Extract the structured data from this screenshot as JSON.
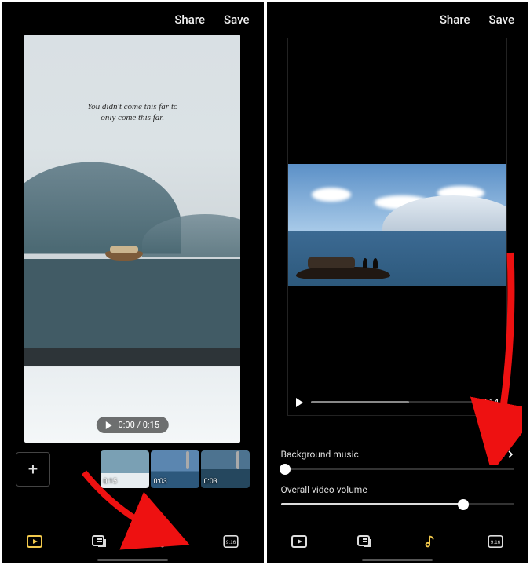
{
  "header": {
    "share": "Share",
    "save": "Save"
  },
  "left": {
    "caption": "You didn't come this far to\nonly come this far.",
    "playback_time": "0:00 / 0:15",
    "clips": [
      {
        "duration": "0:15"
      },
      {
        "duration": "0:03"
      },
      {
        "duration": "0:03"
      }
    ]
  },
  "right": {
    "playback_time_remaining": "0:14",
    "progress_pct": 60,
    "background_music_label": "Background music",
    "background_music_action": "Add",
    "bg_music_slider_value_pct": 2,
    "overall_volume_label": "Overall video volume",
    "overall_volume_value_pct": 78
  },
  "nav": {
    "items": [
      "edit-icon",
      "text-icon",
      "music-icon",
      "aspect-icon"
    ],
    "aspect_label": "9:16",
    "left_active_index": 0,
    "right_active_index": 2
  },
  "icons": {
    "play": "play-icon",
    "add": "add-button",
    "transition": "transition-icon",
    "chevron": "chevron-right-icon"
  }
}
